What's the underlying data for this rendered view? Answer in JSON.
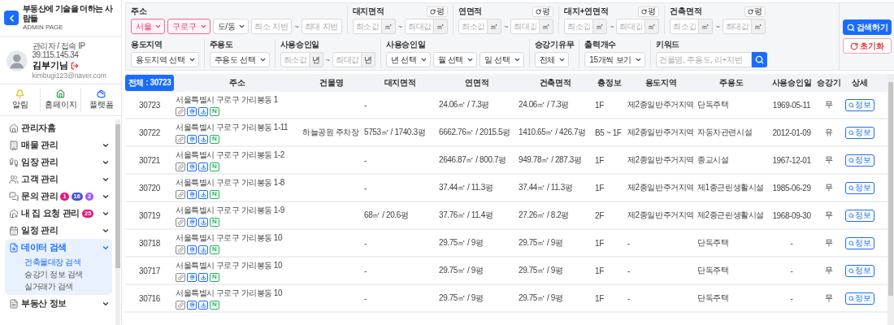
{
  "sidebar": {
    "title": "부동산에 기술을 더하는 사람들",
    "subtitle": "ADMIN PAGE",
    "profile": {
      "role": "관리자 / 접속 IP 39.115.145.34",
      "name": "김부기님",
      "email": "kimbugi123@naver.com"
    },
    "shortcuts": [
      {
        "label": "알림"
      },
      {
        "label": "홈페이지"
      },
      {
        "label": "플랫폼"
      }
    ],
    "menu": [
      {
        "label": "관리자홈",
        "kind": "link",
        "selected": false
      },
      {
        "label": "매물 관리",
        "kind": "group",
        "selected": false,
        "expanded": false
      },
      {
        "label": "임장 관리",
        "kind": "group",
        "selected": false,
        "expanded": false
      },
      {
        "label": "고객 관리",
        "kind": "group",
        "selected": false,
        "expanded": false
      },
      {
        "label": "문의 관리",
        "kind": "group",
        "selected": false,
        "expanded": false,
        "badges": [
          {
            "text": "1",
            "color": "#e8177a"
          },
          {
            "text": "16",
            "color": "#4b52d6"
          },
          {
            "text": "2",
            "color": "#a855f7"
          }
        ]
      },
      {
        "label": "내 집 요청 관리",
        "kind": "group",
        "selected": false,
        "expanded": false,
        "badges": [
          {
            "text": "25",
            "color": "#e8177a"
          }
        ]
      },
      {
        "label": "일정 관리",
        "kind": "group",
        "selected": false,
        "expanded": false
      },
      {
        "label": "데이터 검색",
        "kind": "group",
        "selected": true,
        "expanded": true,
        "children": [
          {
            "label": "건축물대장 검색",
            "selected": true
          },
          {
            "label": "승강기 정보 검색",
            "selected": false
          },
          {
            "label": "실거래가 검색",
            "selected": false
          }
        ]
      },
      {
        "label": "부동산 정보",
        "kind": "group",
        "selected": false,
        "expanded": false
      }
    ]
  },
  "filters": {
    "rows": [
      {
        "groups": [
          {
            "label": "주소",
            "controls": [
              {
                "kind": "select",
                "value": "서울",
                "highlighted": true
              },
              {
                "kind": "select",
                "value": "구로구",
                "highlighted": true
              },
              {
                "kind": "select",
                "value": "도/동",
                "highlighted": false
              },
              {
                "kind": "input",
                "placeholder": "최소 지번"
              },
              {
                "kind": "sep",
                "text": "~"
              },
              {
                "kind": "input",
                "placeholder": "최대 지번"
              }
            ]
          },
          {
            "label": "대지면적",
            "toggle": "평",
            "controls": [
              {
                "kind": "unit_input",
                "placeholder": "최소값",
                "unit": "㎡"
              },
              {
                "kind": "sep",
                "text": "~"
              },
              {
                "kind": "unit_input",
                "placeholder": "최대값",
                "unit": "㎡"
              }
            ]
          },
          {
            "label": "연면적",
            "toggle": "평",
            "controls": [
              {
                "kind": "unit_input",
                "placeholder": "최소값",
                "unit": "㎡"
              },
              {
                "kind": "sep",
                "text": "~"
              },
              {
                "kind": "unit_input",
                "placeholder": "최대값",
                "unit": "㎡"
              }
            ]
          },
          {
            "label": "대지+연면적",
            "toggle": "평",
            "controls": [
              {
                "kind": "unit_input",
                "placeholder": "최소값",
                "unit": "㎡"
              },
              {
                "kind": "sep",
                "text": "~"
              },
              {
                "kind": "unit_input",
                "placeholder": "최대값",
                "unit": "㎡"
              }
            ]
          },
          {
            "label": "건축면적",
            "toggle": "평",
            "controls": [
              {
                "kind": "unit_input",
                "placeholder": "최소값",
                "unit": "㎡"
              },
              {
                "kind": "sep",
                "text": "~"
              },
              {
                "kind": "unit_input",
                "placeholder": "최대값",
                "unit": "㎡"
              }
            ]
          }
        ]
      },
      {
        "groups": [
          {
            "label": "용도지역",
            "controls": [
              {
                "kind": "select",
                "value": "용도지역 선택",
                "highlighted": false
              }
            ]
          },
          {
            "label": "주용도",
            "controls": [
              {
                "kind": "select",
                "value": "주용도 선택",
                "highlighted": false
              }
            ]
          },
          {
            "label": "사용승인일",
            "controls": [
              {
                "kind": "unit_input",
                "placeholder": "최소값",
                "unit": "년"
              },
              {
                "kind": "sep",
                "text": "~"
              },
              {
                "kind": "unit_input",
                "placeholder": "최대값",
                "unit": "년"
              }
            ]
          },
          {
            "label": "사용승인일",
            "controls": [
              {
                "kind": "select",
                "value": "년 선택",
                "highlighted": false
              },
              {
                "kind": "select",
                "value": "월 선택",
                "highlighted": false
              },
              {
                "kind": "select",
                "value": "일 선택",
                "highlighted": false
              }
            ]
          },
          {
            "label": "승강기유무",
            "controls": [
              {
                "kind": "select",
                "value": "전체",
                "highlighted": false
              }
            ]
          },
          {
            "label": "출력개수",
            "controls": [
              {
                "kind": "select",
                "value": "15개씩 보기",
                "highlighted": false
              }
            ]
          },
          {
            "label": "키워드",
            "controls": [
              {
                "kind": "search_input",
                "placeholder": "건물명, 주용도, 리+지번"
              }
            ]
          }
        ]
      }
    ],
    "buttons": [
      {
        "label": "검색하기",
        "kind": "primary"
      },
      {
        "label": "초기화",
        "kind": "reset"
      }
    ]
  },
  "table": {
    "total": "전체 : 30723",
    "columns": [
      "주소",
      "건물명",
      "대지면적",
      "연면적",
      "건축면적",
      "층정보",
      "용도지역",
      "주용도",
      "사용승인일",
      "승강기",
      "상세"
    ],
    "rows": [
      {
        "no": "30723",
        "address": "서울특별시 구로구 가리봉동 1",
        "mark": "N",
        "land_area": "-",
        "floor_area": "24.06㎡ / 7.3평",
        "building_area": "24.06㎡ / 7.3평",
        "floors": "1F",
        "zone": "제2종일반주거지역",
        "use": "단독주택",
        "approval_date": "1969-05-11",
        "elevator": "무",
        "detail": "정보"
      },
      {
        "no": "30722",
        "address": "서울특별시 구로구 가리봉동 1-11",
        "mark": "N",
        "building": "하늘공원 주차장",
        "land_area": "5753㎡ / 1740.3평",
        "floor_area": "6662.76㎡ / 2015.5평",
        "building_area": "1410.65㎡ / 426.7평",
        "floors": "B5 ~ 1F",
        "zone": "제2종일반주거지역",
        "use": "자동차관련시설",
        "approval_date": "2012-01-09",
        "elevator": "유",
        "detail": "정보"
      },
      {
        "no": "30721",
        "address": "서울특별시 구로구 가리봉동 1-2",
        "mark": "N",
        "land_area": "-",
        "floor_area": "2646.87㎡ / 800.7평",
        "building_area": "949.78㎡ / 287.3평",
        "floors": "1F",
        "zone": "제2종일반주거지역",
        "use": "종교시설",
        "approval_date": "1967-12-01",
        "elevator": "무",
        "detail": "정보"
      },
      {
        "no": "30720",
        "address": "서울특별시 구로구 가리봉동 1-8",
        "mark": "N",
        "land_area": "-",
        "floor_area": "37.44㎡ / 11.3평",
        "building_area": "37.44㎡ / 11.3평",
        "floors": "1F",
        "zone": "제2종일반주거지역",
        "use": "제1종근린생활시설",
        "approval_date": "1985-06-29",
        "elevator": "무",
        "detail": "정보"
      },
      {
        "no": "30719",
        "address": "서울특별시 구로구 가리봉동 1-9",
        "mark": "N",
        "land_area": "68㎡ / 20.6평",
        "floor_area": "37.76㎡ / 11.4평",
        "building_area": "27.26㎡ / 8.2평",
        "floors": "2F",
        "zone": "제2종일반주거지역",
        "use": "제2종근린생활시설",
        "approval_date": "1968-09-30",
        "elevator": "무",
        "detail": "정보"
      },
      {
        "no": "30718",
        "address": "서울특별시 구로구 가리봉동 10",
        "mark": "N",
        "land_area": "-",
        "floor_area": "29.75㎡ / 9평",
        "building_area": "29.75㎡ / 9평",
        "floors": "1F",
        "zone": "-",
        "use": "단독주택",
        "approval_date": "-",
        "elevator": "무",
        "detail": "정보"
      },
      {
        "no": "30717",
        "address": "서울특별시 구로구 가리봉동 10",
        "mark": "N",
        "land_area": "-",
        "floor_area": "29.75㎡ / 9평",
        "building_area": "29.75㎡ / 9평",
        "floors": "1F",
        "zone": "-",
        "use": "단독주택",
        "approval_date": "-",
        "elevator": "무",
        "detail": "정보"
      },
      {
        "no": "30716",
        "address": "서울특별시 구로구 가리봉동 10",
        "mark": "N",
        "land_area": "-",
        "floor_area": "29.75㎡ / 9평",
        "building_area": "29.75㎡ / 9평",
        "floors": "1F",
        "zone": "-",
        "use": "단독주택",
        "approval_date": "-",
        "elevator": "무",
        "detail": "정보"
      }
    ]
  }
}
